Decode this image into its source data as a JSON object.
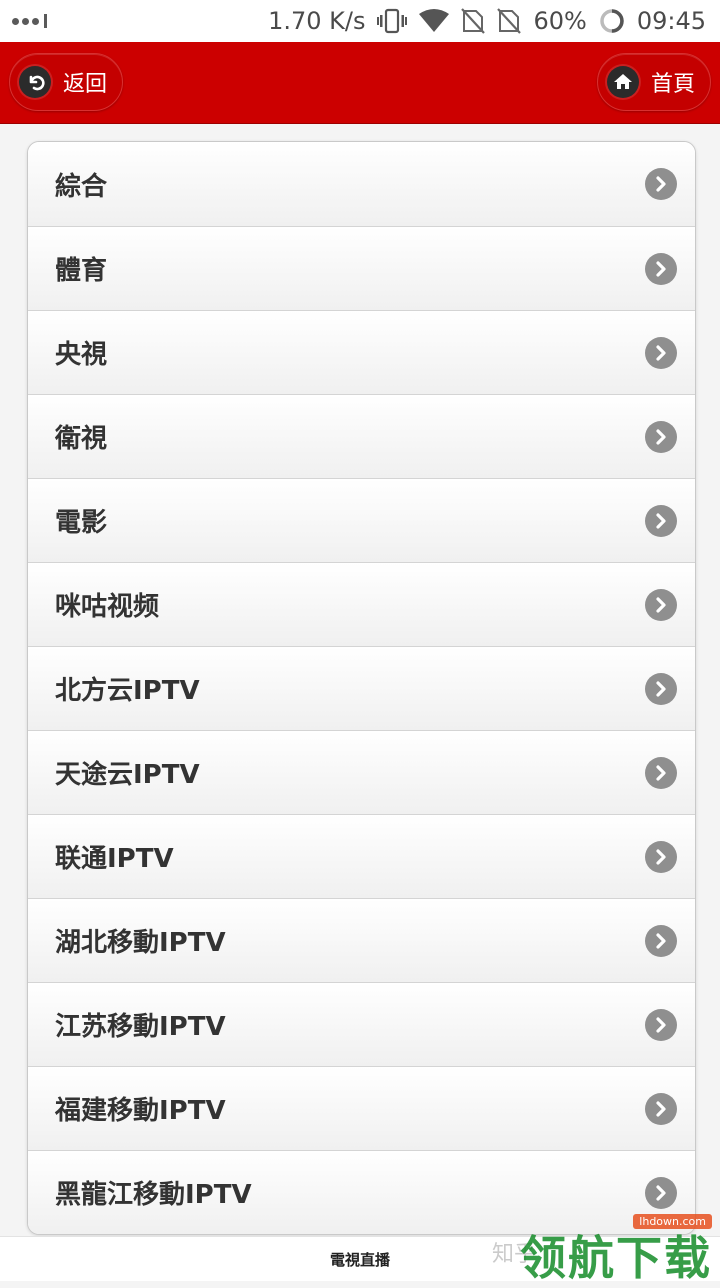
{
  "status_bar": {
    "speed": "1.70 K/s",
    "battery": "60%",
    "time": "09:45"
  },
  "header": {
    "back_label": "返回",
    "home_label": "首頁"
  },
  "list": {
    "items": [
      {
        "label": "綜合"
      },
      {
        "label": "體育"
      },
      {
        "label": "央視"
      },
      {
        "label": "衛視"
      },
      {
        "label": "電影"
      },
      {
        "label": "咪咕视频"
      },
      {
        "label": "北方云IPTV"
      },
      {
        "label": "天途云IPTV"
      },
      {
        "label": "联通IPTV"
      },
      {
        "label": "湖北移動IPTV"
      },
      {
        "label": "江苏移動IPTV"
      },
      {
        "label": "福建移動IPTV"
      },
      {
        "label": "黑龍江移動IPTV"
      }
    ]
  },
  "footer": {
    "title": "電視直播"
  },
  "watermark": {
    "zhihu": "知乎",
    "brand": "领航下载",
    "site": "lhdown.com"
  },
  "colors": {
    "header_red": "#cc0000",
    "chevron_gray": "#8f8f8f",
    "text_dark": "#333333"
  },
  "icons": {
    "back": "back-arrow-icon",
    "home": "home-icon",
    "row": "chevron-right-icon"
  }
}
